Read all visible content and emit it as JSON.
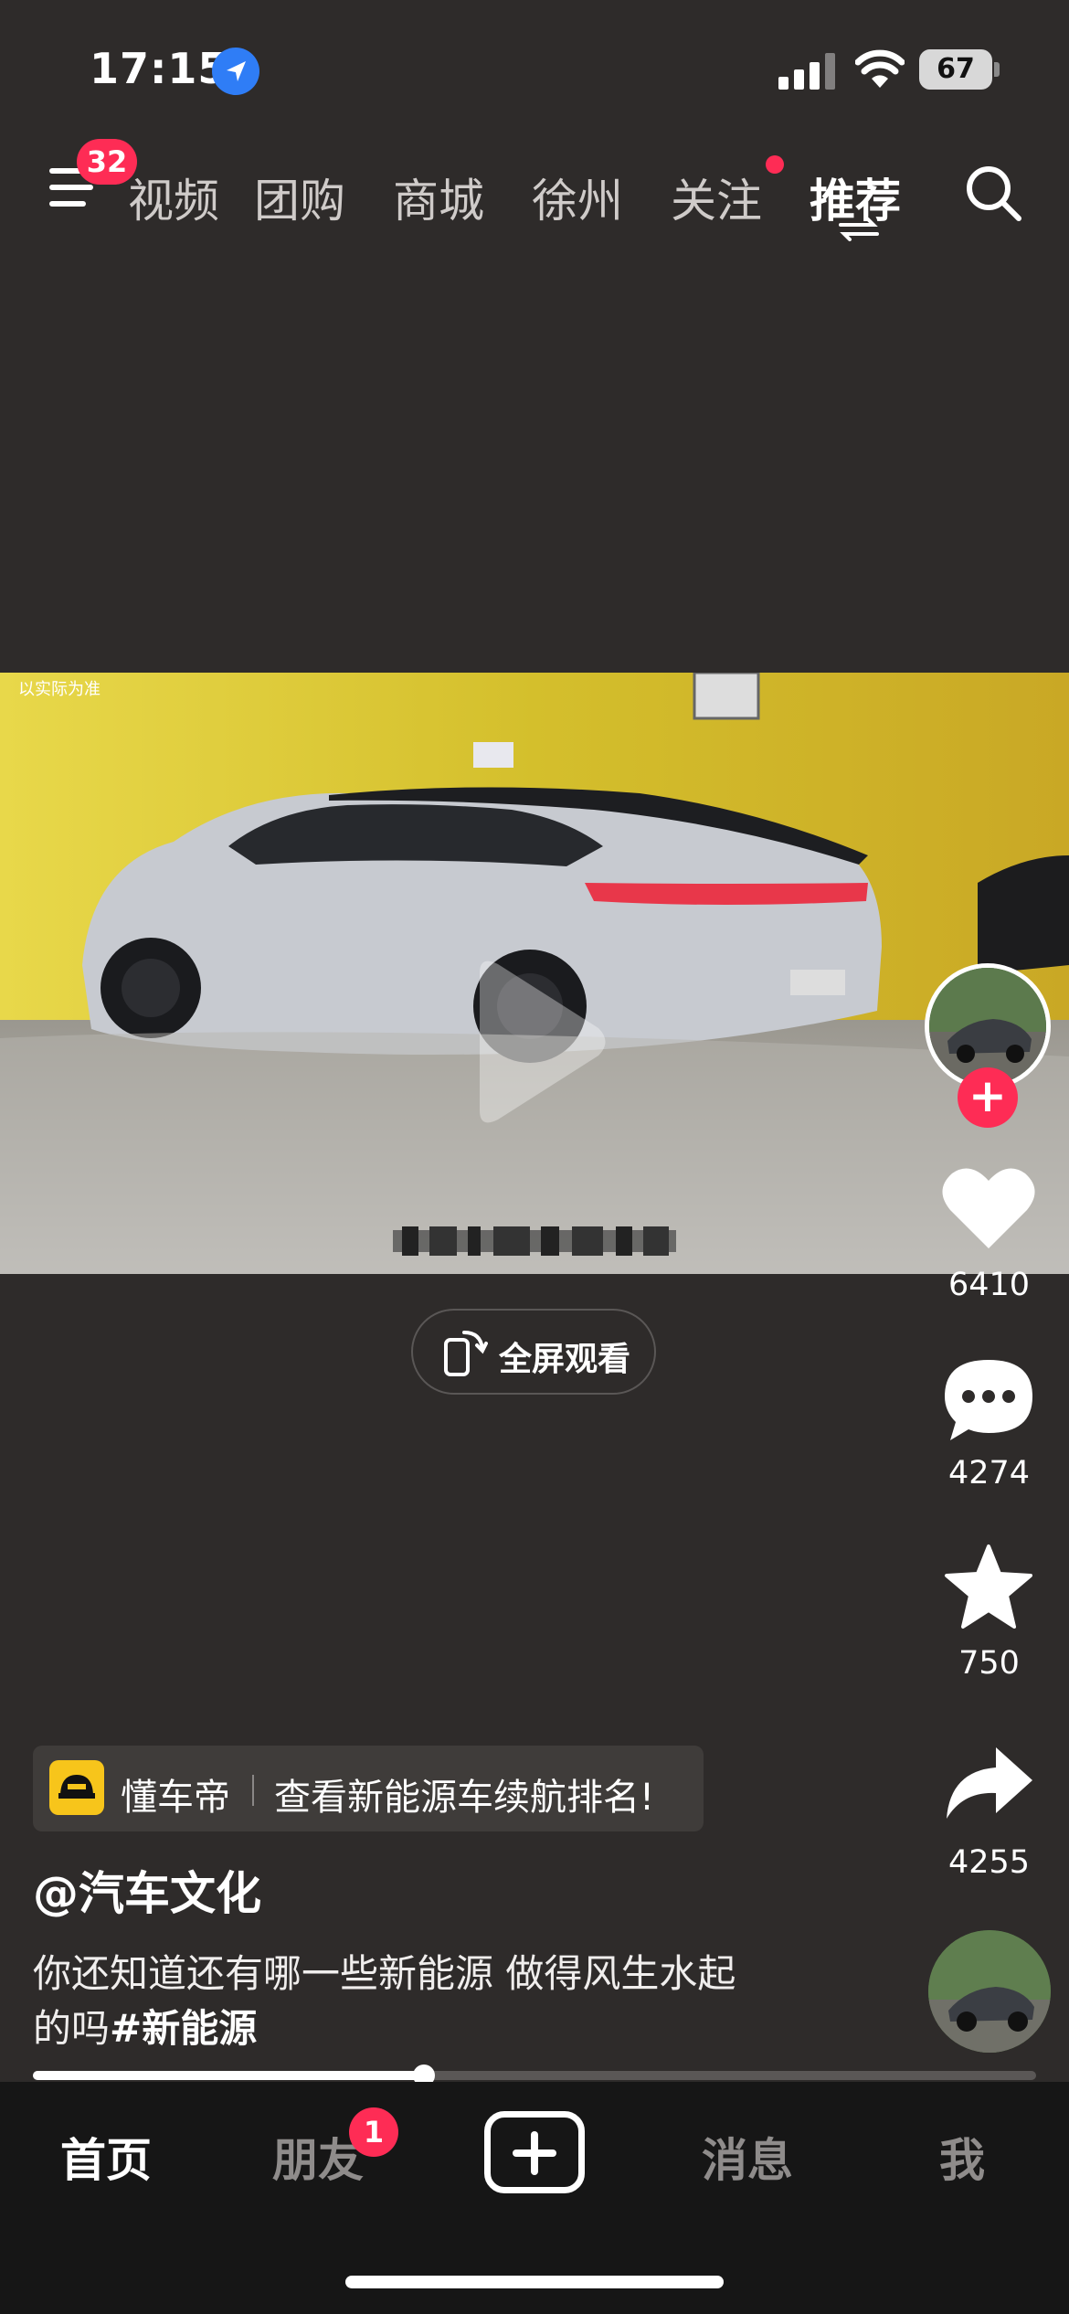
{
  "status_bar": {
    "time": "17:15",
    "battery": "67"
  },
  "top_nav": {
    "menu_badge": "32",
    "tabs": [
      "视频",
      "团购",
      "商城",
      "徐州",
      "关注",
      "推荐"
    ]
  },
  "video": {
    "watermark": "以实际为准",
    "fullscreen_label": "全屏观看"
  },
  "actions": {
    "likes": "6410",
    "comments": "4274",
    "favorites": "750",
    "shares": "4255"
  },
  "ad": {
    "brand": "懂车帝",
    "text": "查看新能源车续航排名!"
  },
  "post": {
    "username": "@汽车文化",
    "caption_line1": "你还知道还有哪一些新能源 做得风生水起",
    "caption_line2_prefix": "的吗",
    "hashtag": "#新能源"
  },
  "progress": {
    "fraction": 0.39
  },
  "bottom_tabs": {
    "home": "首页",
    "friends": "朋友",
    "friends_badge": "1",
    "messages": "消息",
    "me": "我"
  },
  "colors": {
    "accent": "#fe2c55",
    "background": "#2e2b2a",
    "tabbar": "#161616"
  }
}
